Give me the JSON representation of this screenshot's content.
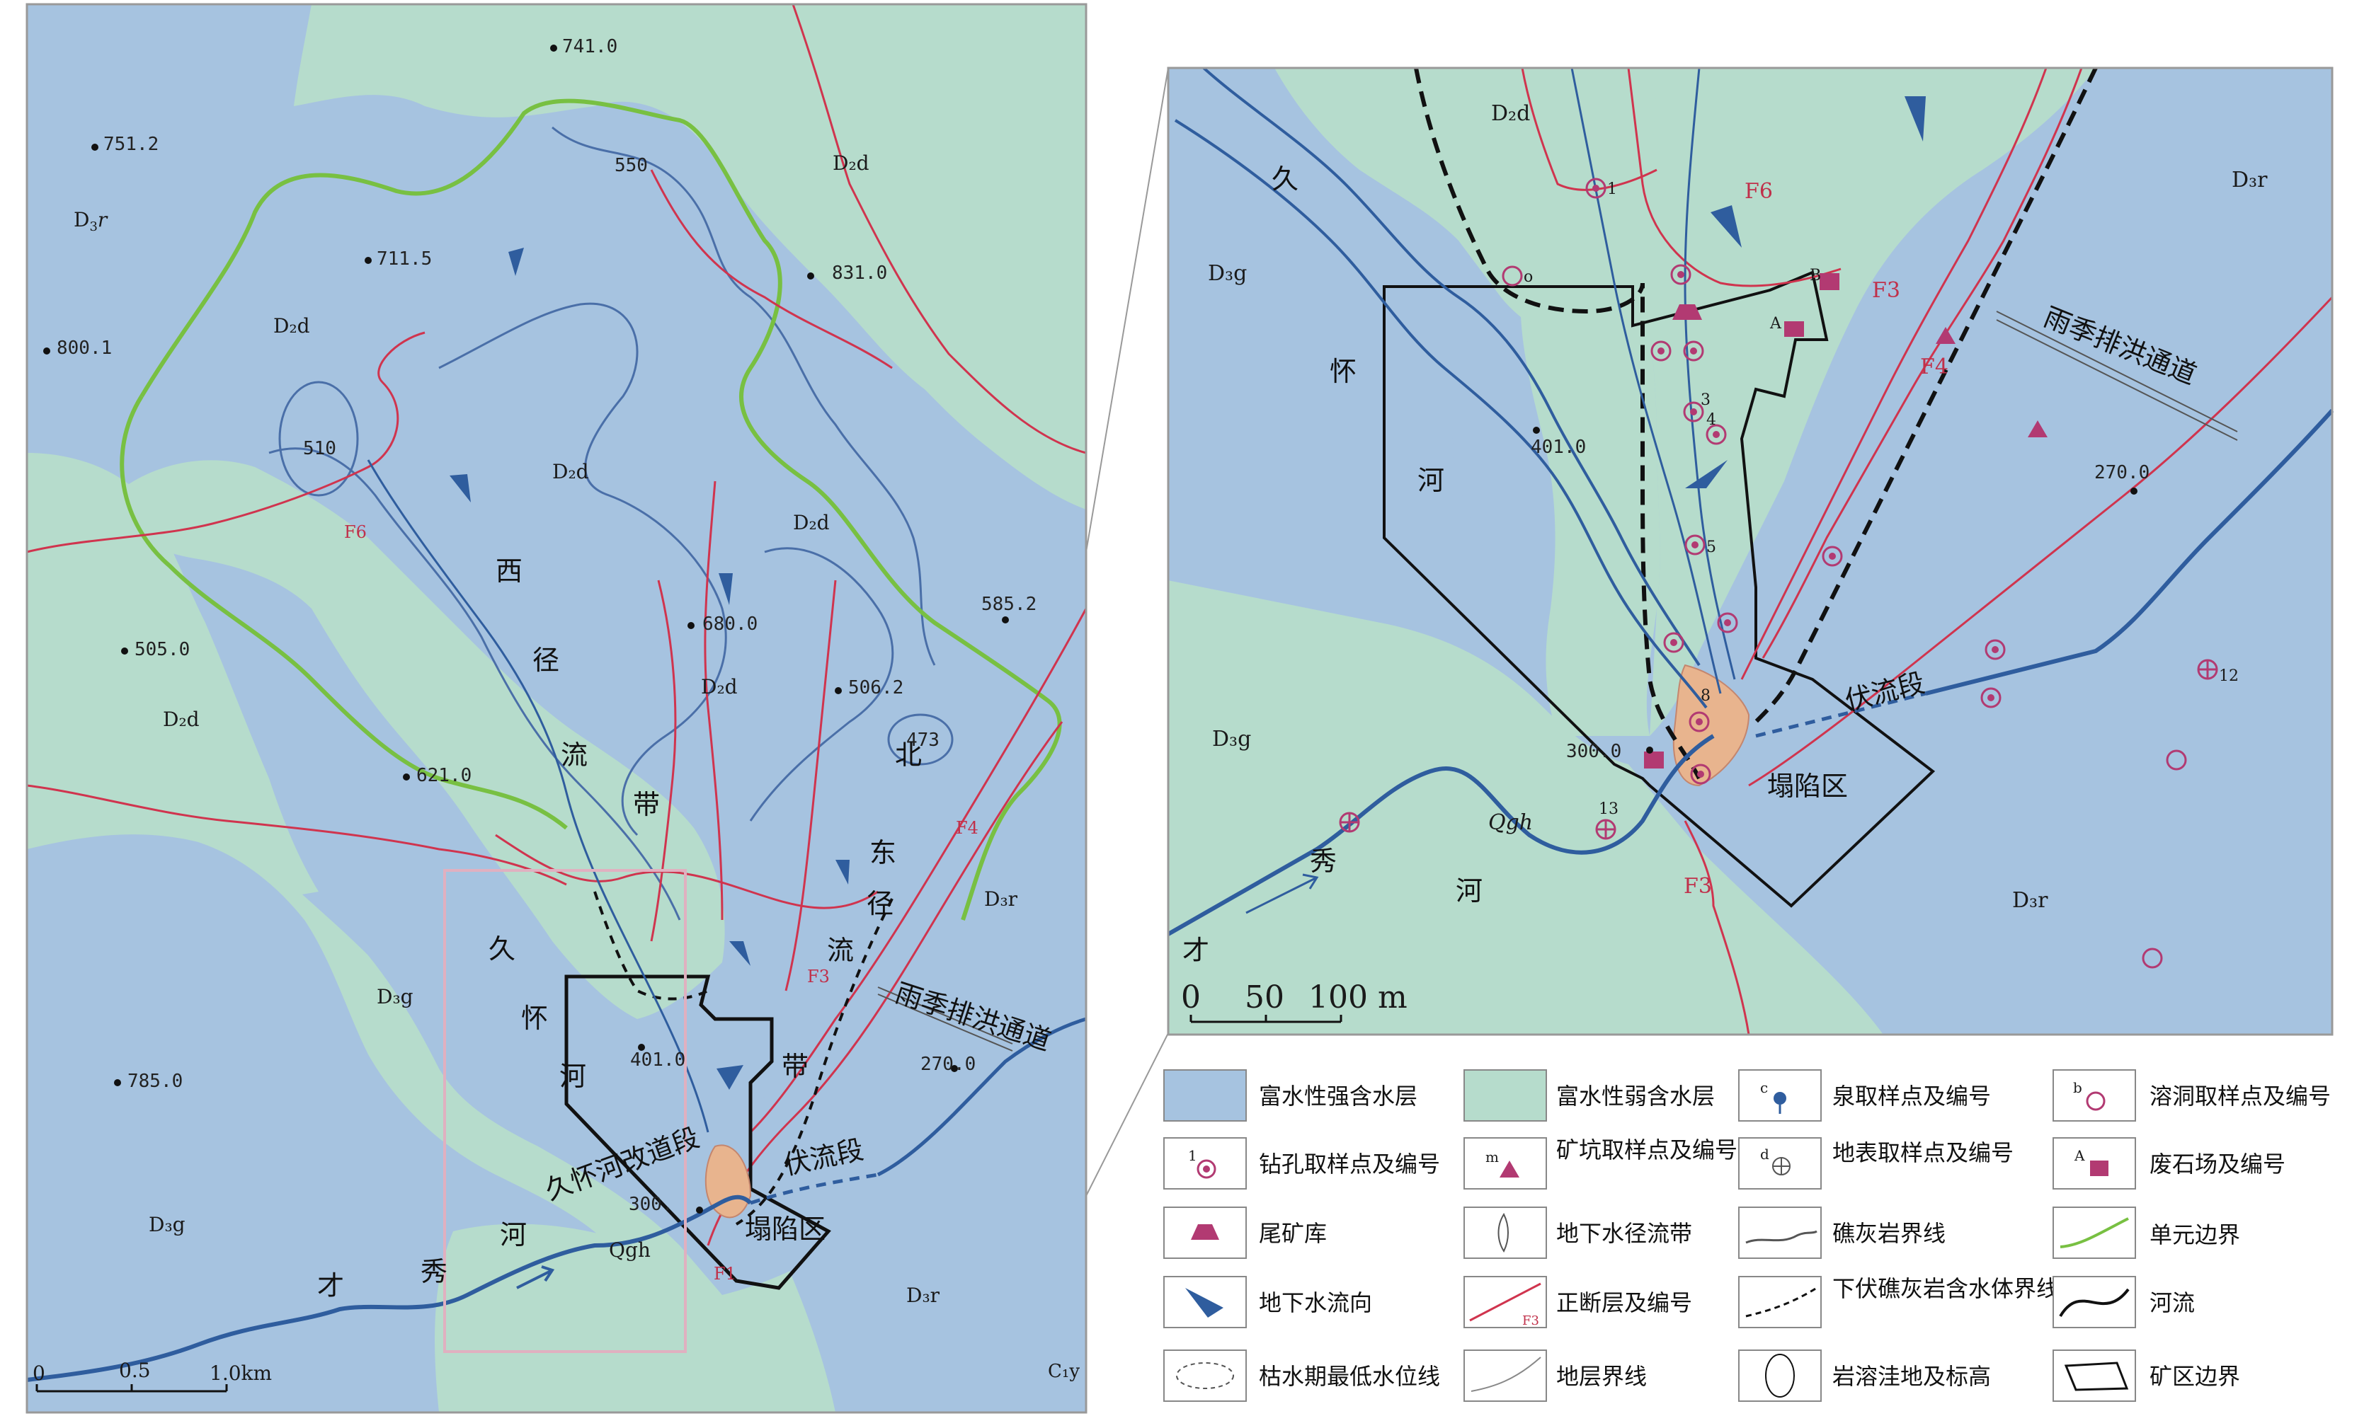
{
  "colors": {
    "strong_aquifer": "#a6c3e0",
    "weak_aquifer": "#b6dccc",
    "river": "#2f5d9e",
    "fault": "#d0344e",
    "unit_boundary": "#78c042",
    "mine_boundary": "#111111",
    "collapse": "#e8b48e"
  },
  "main_map": {
    "elevations": [
      {
        "text": "741.0"
      },
      {
        "text": "751.2"
      },
      {
        "text": "711.5"
      },
      {
        "text": "831.0"
      },
      {
        "text": "800.1"
      },
      {
        "text": "505.0"
      },
      {
        "text": "680.0"
      },
      {
        "text": "585.2"
      },
      {
        "text": "506.2"
      },
      {
        "text": "621.0"
      },
      {
        "text": "785.0"
      },
      {
        "text": "401.0"
      },
      {
        "text": "270.0"
      },
      {
        "text": "300."
      }
    ],
    "contours": {
      "c550": "550",
      "c510": "510",
      "c473": "473"
    },
    "strata": {
      "d3r_nw": "D",
      "d2d_ne": "D₂d",
      "d2d_c1": "D₂d",
      "d2d_c2": "D₂d",
      "d2d_c3": "D₂d",
      "d2d_c4": "D₂d",
      "d2d_w": "D₂d",
      "d3g_w": "D₃g",
      "d3g_sw": "D₃g",
      "d3r_e": "D₃r",
      "d3r_se": "D₃r",
      "qgh": "Qgh",
      "c": "C₁y"
    },
    "faults": {
      "f6": "F6",
      "f4": "F4",
      "f3": "F3",
      "f1": "F1"
    },
    "labels": {
      "west_zone": [
        "西",
        "径",
        "流",
        "带"
      ],
      "northeast_zone": [
        "北",
        "东",
        "径",
        "流",
        "带"
      ],
      "jiuhuai": [
        "久",
        "怀",
        "河"
      ],
      "reroute": "久怀河改道段",
      "underflow": "伏流段",
      "collapse": "塌陷区",
      "caixiu": [
        "才",
        "秀",
        "河"
      ],
      "flood_channel": "雨季排洪通道"
    },
    "scale": {
      "zero": "0",
      "half": "0.5",
      "one": "1.0km"
    }
  },
  "inset_map": {
    "strata": {
      "d2d": "D₂d",
      "d3g_1": "D₃g",
      "d3g_2": "D₃g",
      "d3r_1": "D₃r",
      "d3r_2": "D₃r",
      "qgh": "Qgh"
    },
    "elevations": [
      {
        "text": "401.0"
      },
      {
        "text": "270.0"
      },
      {
        "text": "300.0"
      }
    ],
    "labels": {
      "jiuhuai": [
        "久",
        "怀",
        "河"
      ],
      "caixiu": [
        "才",
        "秀",
        "河"
      ],
      "underflow": "伏流段",
      "collapse": "塌陷区",
      "flood_channel": "雨季排洪通道"
    },
    "faults": {
      "f6": "F6",
      "f3a": "F3",
      "f4": "F4",
      "f3b": "F3"
    },
    "sample_ids": {
      "s1": "1",
      "o": "o",
      "s3": "3",
      "s4": "4",
      "s5": "5",
      "s8": "8",
      "s13": "13",
      "s12": "12",
      "B": "B",
      "A": "A"
    },
    "scale": {
      "zero": "0",
      "fifty": "50",
      "hundred": "100 m"
    }
  },
  "legend": [
    {
      "label": "富水性强含水层",
      "icon": "strong-aquifer-swatch"
    },
    {
      "label": "富水性弱含水层",
      "icon": "weak-aquifer-swatch"
    },
    {
      "label": "泉取样点及编号",
      "icon": "spring-sample-icon"
    },
    {
      "label": "溶洞取样点及编号",
      "icon": "cave-sample-icon"
    },
    {
      "label": "钻孔取样点及编号",
      "icon": "borehole-sample-icon"
    },
    {
      "label": "矿坑取样点及编号",
      "icon": "mine-pit-sample-icon"
    },
    {
      "label": "地表取样点及编号",
      "icon": "surface-sample-icon"
    },
    {
      "label": "废石场及编号",
      "icon": "waste-rock-icon"
    },
    {
      "label": "尾矿库",
      "icon": "tailings-pond-icon"
    },
    {
      "label": "地下水径流带",
      "icon": "groundwater-runoff-icon"
    },
    {
      "label": "礁灰岩界线",
      "icon": "reef-limestone-line-icon"
    },
    {
      "label": "单元边界",
      "icon": "unit-boundary-icon"
    },
    {
      "label": "地下水流向",
      "icon": "flow-direction-icon"
    },
    {
      "label": "正断层及编号",
      "icon": "normal-fault-icon"
    },
    {
      "label": "下伏礁灰岩含水体界线",
      "icon": "underlying-reef-icon"
    },
    {
      "label": "河流",
      "icon": "river-icon"
    },
    {
      "label": "枯水期最低水位线",
      "icon": "low-water-line-icon"
    },
    {
      "label": "地层界线",
      "icon": "stratum-line-icon"
    },
    {
      "label": "岩溶洼地及标高",
      "icon": "karst-depression-icon"
    },
    {
      "label": "矿区边界",
      "icon": "mine-boundary-icon"
    }
  ],
  "legend_sub": {
    "spring": "c",
    "cave": "b",
    "borehole": "1",
    "minepit": "m",
    "surface": "d",
    "waste": "A",
    "fault": "F3"
  }
}
